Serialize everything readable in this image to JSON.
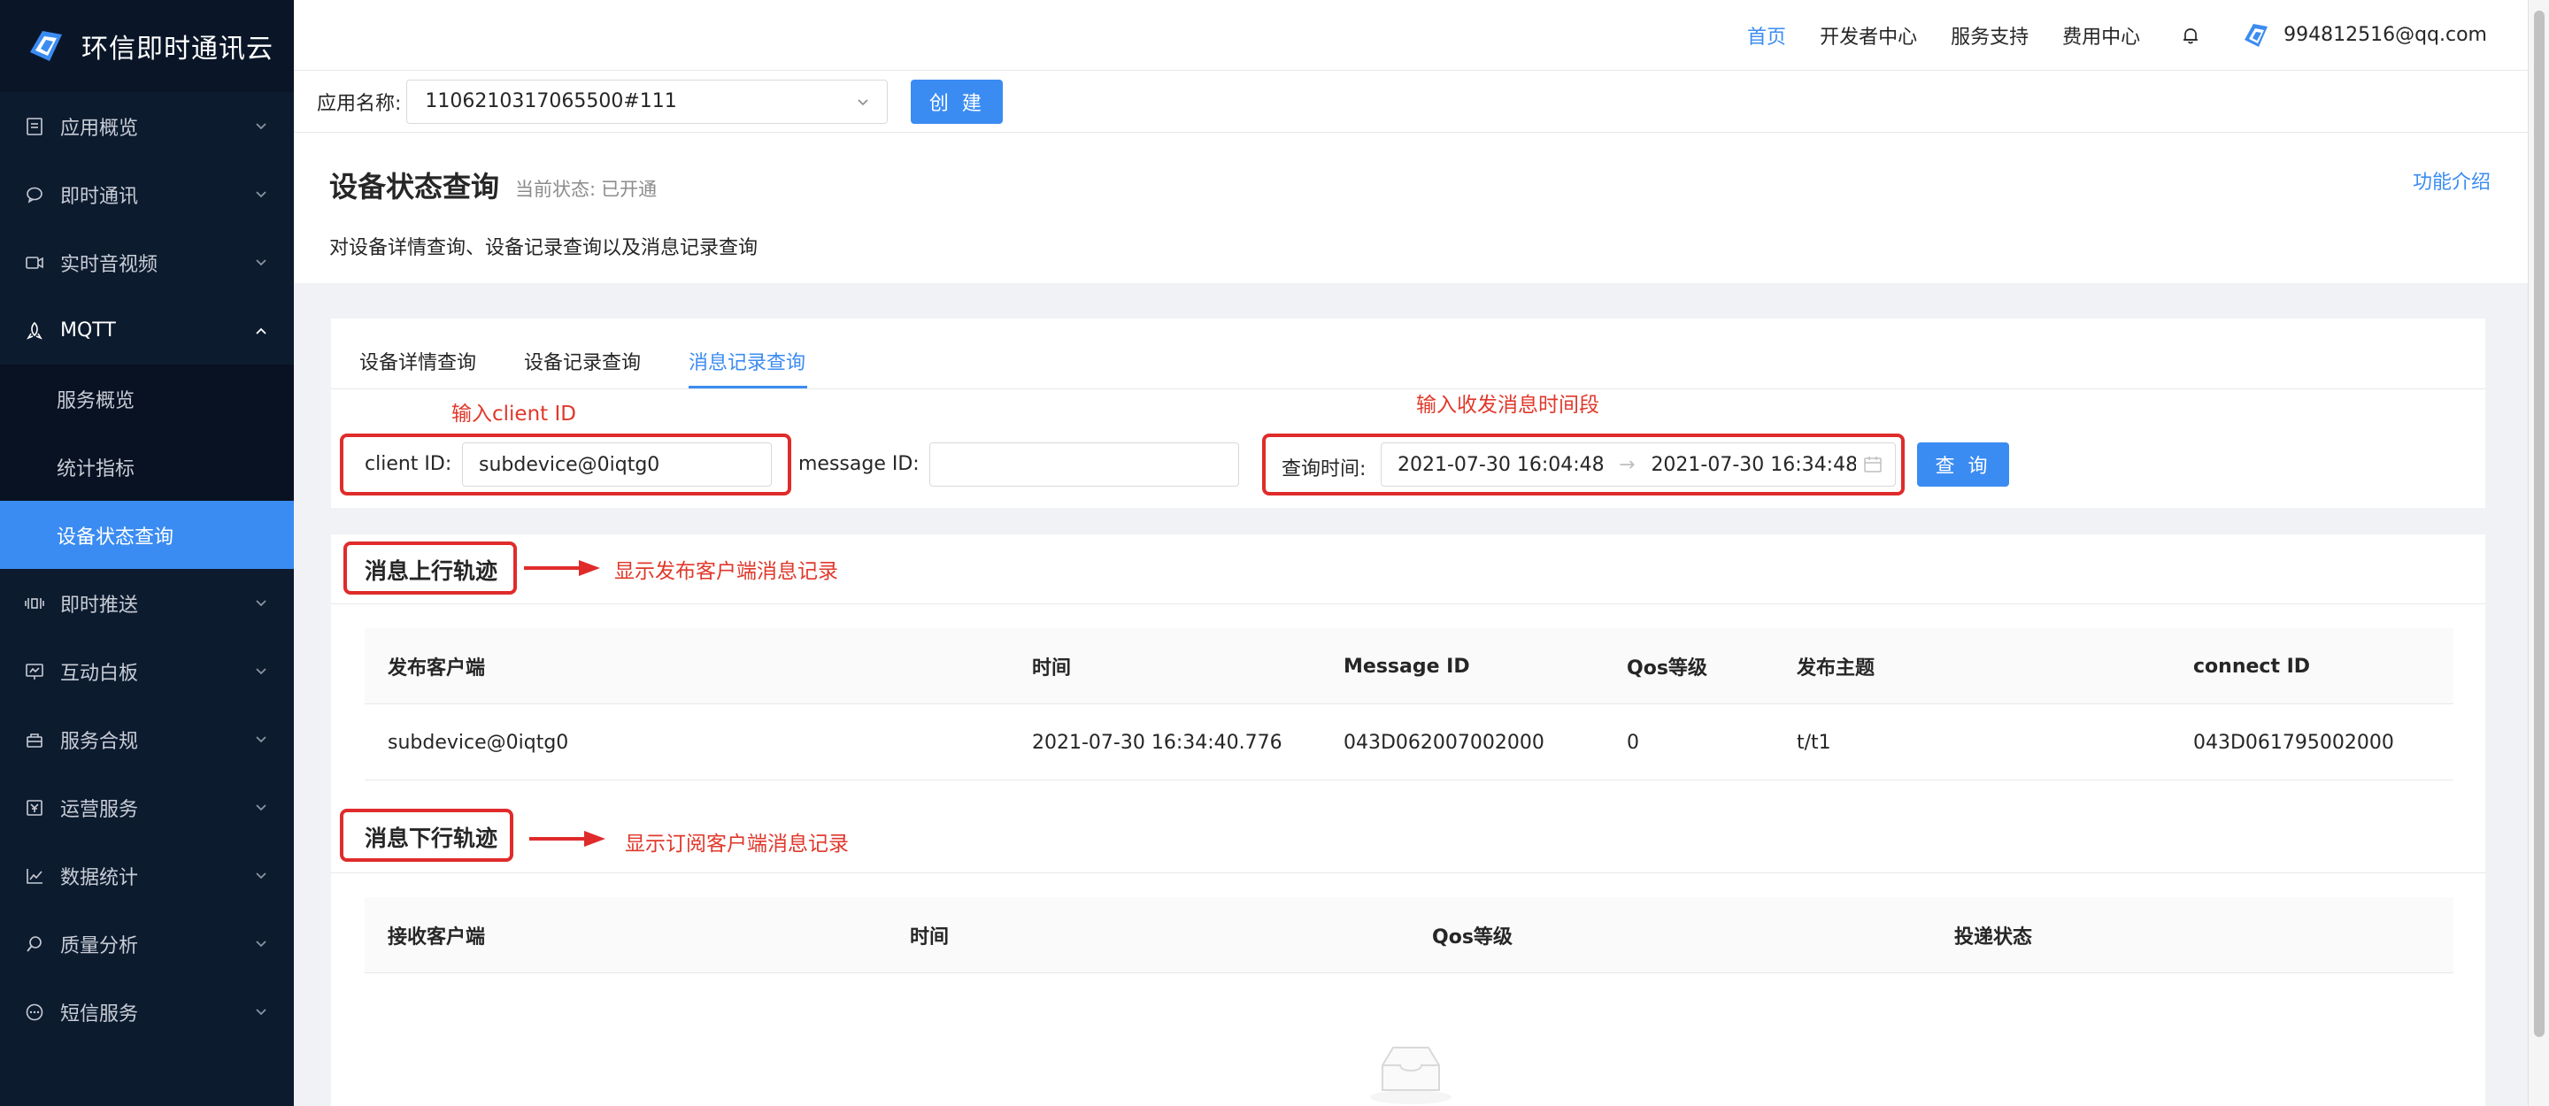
{
  "brand": {
    "name": "环信即时通讯云"
  },
  "sidebar": {
    "items": [
      {
        "label": "应用概览",
        "icon": "doc-icon"
      },
      {
        "label": "即时通讯",
        "icon": "chat-icon"
      },
      {
        "label": "实时音视频",
        "icon": "video-icon"
      },
      {
        "label": "MQTT",
        "icon": "mqtt-icon",
        "expanded": true,
        "children": [
          {
            "label": "服务概览"
          },
          {
            "label": "统计指标"
          },
          {
            "label": "设备状态查询",
            "active": true
          }
        ]
      },
      {
        "label": "即时推送",
        "icon": "push-icon"
      },
      {
        "label": "互动白板",
        "icon": "whiteboard-icon"
      },
      {
        "label": "服务合规",
        "icon": "compliance-icon"
      },
      {
        "label": "运营服务",
        "icon": "operation-icon"
      },
      {
        "label": "数据统计",
        "icon": "stats-icon"
      },
      {
        "label": "质量分析",
        "icon": "quality-icon"
      },
      {
        "label": "短信服务",
        "icon": "sms-icon"
      }
    ]
  },
  "header": {
    "links": [
      "首页",
      "开发者中心",
      "服务支持",
      "费用中心"
    ],
    "active_link": "首页",
    "user_email": "994812516@qq.com"
  },
  "appbar": {
    "label": "应用名称:",
    "selected_app": "1106210317065500#111",
    "create_label": "创 建"
  },
  "page": {
    "title": "设备状态查询",
    "status_label": "当前状态:",
    "status_value": "已开通",
    "description": "对设备详情查询、设备记录查询以及消息记录查询",
    "feature_link": "功能介绍"
  },
  "tabs": [
    "设备详情查询",
    "设备记录查询",
    "消息记录查询"
  ],
  "active_tab": 2,
  "filters": {
    "client_id_label": "client ID:",
    "client_id_value": "subdevice@0iqtg0",
    "message_id_label": "message ID:",
    "message_id_value": "",
    "time_label": "查询时间:",
    "start_time": "2021-07-30 16:04:48",
    "end_time": "2021-07-30 16:34:48",
    "query_label": "查 询"
  },
  "annotations": {
    "client_hint": "输入client ID",
    "time_hint": "输入收发消息时间段",
    "upstream_hint": "显示发布客户端消息记录",
    "downstream_hint": "显示订阅客户端消息记录"
  },
  "upstream": {
    "title": "消息上行轨迹",
    "columns": [
      "发布客户端",
      "时间",
      "Message ID",
      "Qos等级",
      "发布主题",
      "connect ID"
    ],
    "rows": [
      [
        "subdevice@0iqtg0",
        "2021-07-30 16:34:40.776",
        "043D062007002000",
        "0",
        "t/t1",
        "043D061795002000"
      ]
    ]
  },
  "downstream": {
    "title": "消息下行轨迹",
    "columns": [
      "接收客户端",
      "时间",
      "Qos等级",
      "投递状态"
    ],
    "rows": []
  },
  "colors": {
    "accent": "#3b8cf2",
    "annotation": "#e02b2b",
    "sidebar_bg": "#0d1b2f"
  }
}
